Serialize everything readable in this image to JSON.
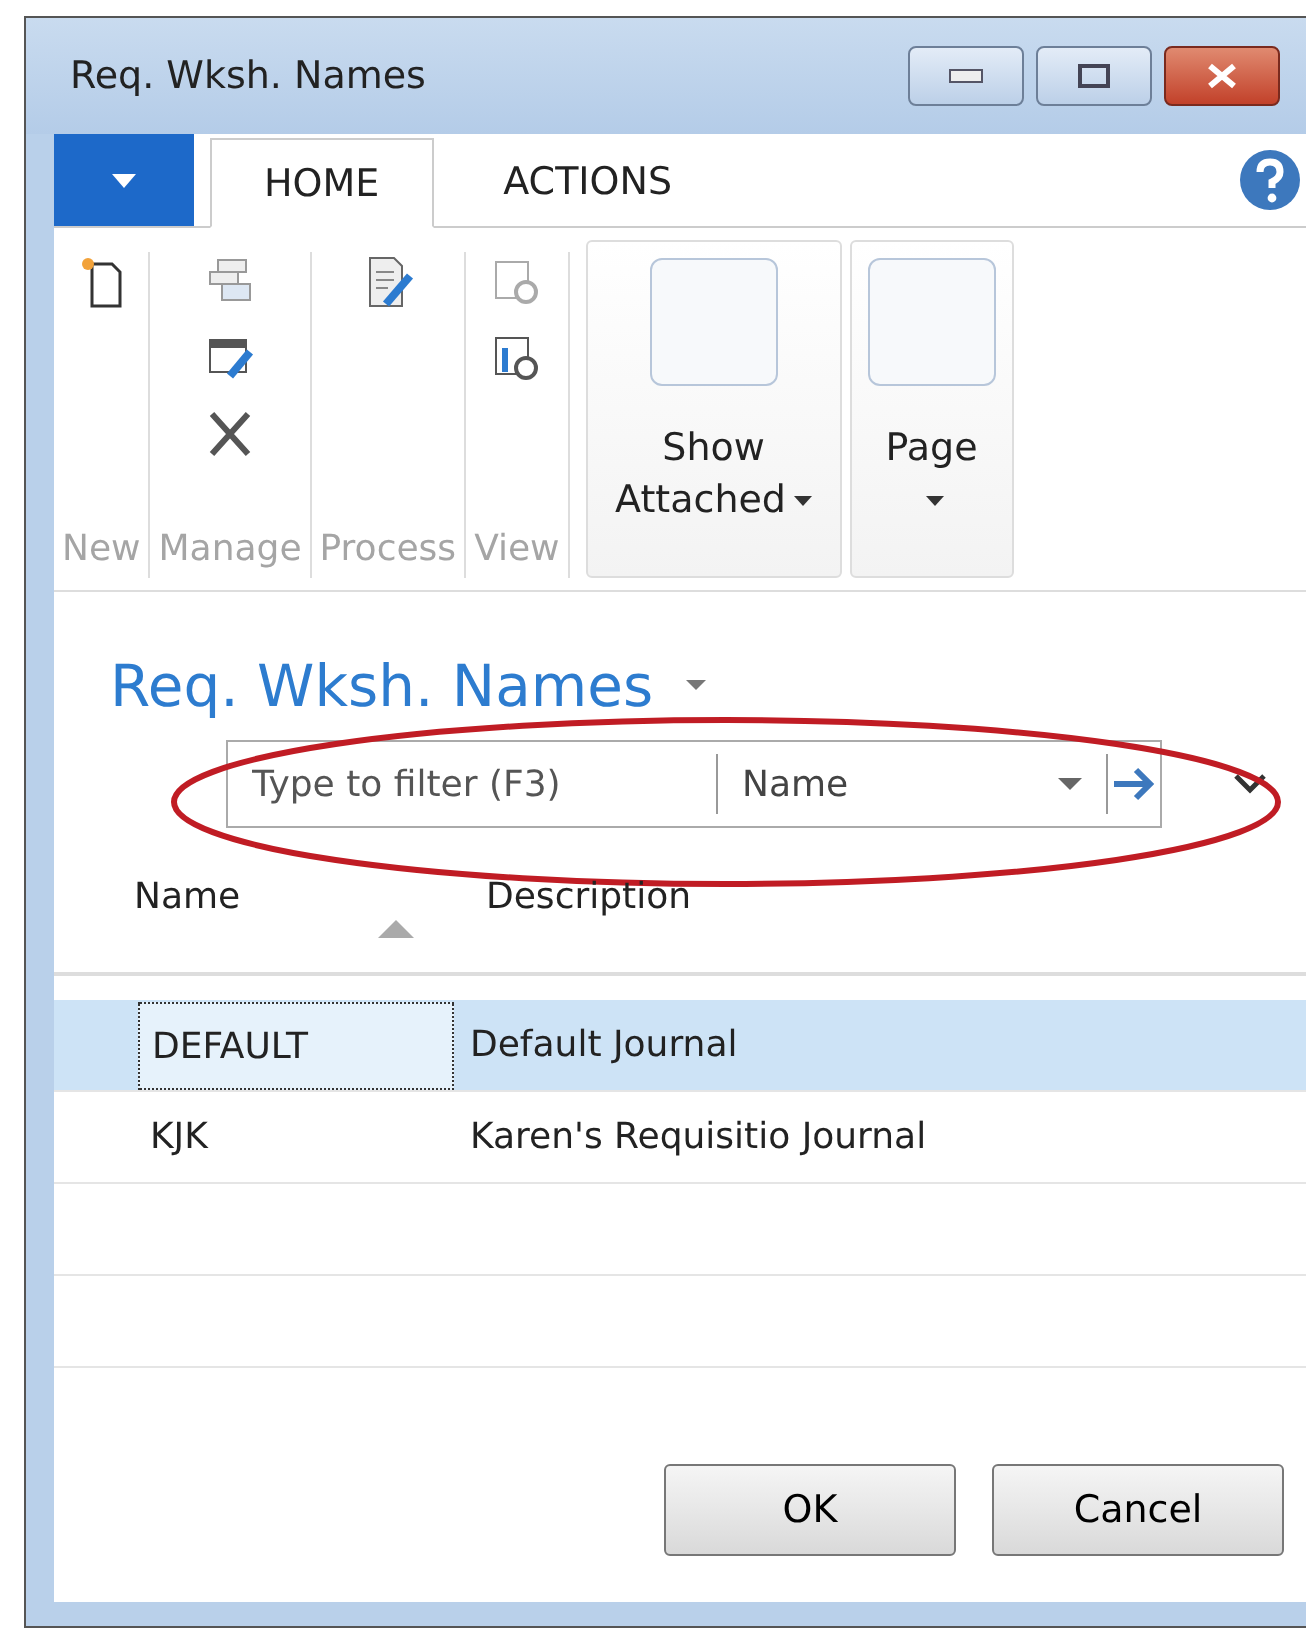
{
  "window": {
    "title": "Req. Wksh. Names"
  },
  "tabs": [
    {
      "label": "HOME",
      "selected": true
    },
    {
      "label": "ACTIONS",
      "selected": false
    }
  ],
  "ribbon_groups": [
    {
      "label": "New",
      "disabled": true,
      "icons": [
        {
          "kind": "new"
        }
      ]
    },
    {
      "label": "Manage",
      "disabled": true,
      "icons": [
        {
          "kind": "form"
        },
        {
          "kind": "edit-list"
        },
        {
          "kind": "delete"
        }
      ]
    },
    {
      "label": "Process",
      "disabled": true,
      "icons": [
        {
          "kind": "edit-doc"
        }
      ]
    },
    {
      "label": "View",
      "disabled": true,
      "icons": [
        {
          "kind": "view"
        },
        {
          "kind": "view-list"
        }
      ]
    }
  ],
  "large_buttons": [
    {
      "label": "Show Attached",
      "dropdown": true,
      "wrap": false
    },
    {
      "label": "Page",
      "dropdown": true,
      "wrap": true
    }
  ],
  "page_title": "Req. Wksh. Names",
  "filter": {
    "placeholder": "Type to filter (F3)",
    "field": "Name"
  },
  "columns": [
    {
      "label": "Name",
      "sorted": true
    },
    {
      "label": "Description",
      "sorted": false
    }
  ],
  "rows": [
    {
      "name": "DEFAULT",
      "description": "Default Journal",
      "selected": true
    },
    {
      "name": "KJK",
      "description": "Karen's Requisitio Journal",
      "selected": false
    }
  ],
  "buttons": [
    "OK",
    "Cancel"
  ]
}
